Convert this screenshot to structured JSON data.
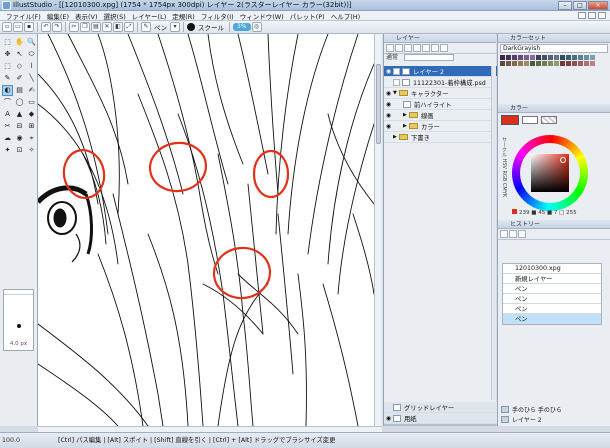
{
  "title_bar": {
    "title": "IllustStudio - [[12010300.xpg] (1754 * 1754px 300dpi)  レイヤー 2(ラスターレイヤー カラー(32bit))]",
    "window_buttons": [
      "–",
      "□",
      "×"
    ]
  },
  "menu": [
    "ファイル(F)",
    "編集(E)",
    "表示(V)",
    "選択(S)",
    "レイヤー(L)",
    "定規(R)",
    "フィルタ(I)",
    "ウィンドウ(W)",
    "パレット(P)",
    "ヘルプ(H)"
  ],
  "command_bar": {
    "tool_name": "ペン",
    "brush_label": "スクール",
    "badge": "3%",
    "icons": [
      "new-file-icon",
      "open-icon",
      "save-icon",
      "undo-icon",
      "redo-icon",
      "cut-icon",
      "copy-icon"
    ]
  },
  "tools": [
    "⬚",
    "✋",
    "🔍",
    "✥",
    "↖",
    "⬭",
    "⬚",
    "◇",
    "⌇",
    "✎",
    "✐",
    "╲",
    "◐",
    "▤",
    "✍",
    "⌒",
    "◯",
    "▭",
    "A",
    "▲",
    "◆",
    "✂",
    "⊟",
    "⊞",
    "☁",
    "◉",
    "⌖",
    "✦",
    "⊡",
    "✧"
  ],
  "brush_size": "4.0 px",
  "layer_panel": {
    "header": "レイヤー",
    "blend_mode": "通常",
    "layers": [
      {
        "name": "レイヤー 2",
        "selected": true,
        "indent": 0,
        "kind": "raster"
      },
      {
        "name": "11122301-着枠構成.psd",
        "selected": false,
        "indent": 0,
        "kind": "image"
      },
      {
        "name": "キャラクター",
        "selected": false,
        "indent": 0,
        "kind": "folder"
      },
      {
        "name": "前ハイライト",
        "selected": false,
        "indent": 1,
        "kind": "raster"
      },
      {
        "name": "線画",
        "selected": false,
        "indent": 2,
        "kind": "folder"
      },
      {
        "name": "カラー",
        "selected": false,
        "indent": 2,
        "kind": "folder"
      },
      {
        "name": "下書き",
        "selected": false,
        "indent": 1,
        "kind": "folder"
      }
    ],
    "bottom_layers": [
      "グリッドレイヤー",
      "用紙"
    ]
  },
  "color_set": {
    "header": "カラーセット",
    "name": "DarkGrayish"
  },
  "color_panel": {
    "header": "カラー",
    "main_color": "#d8301d",
    "tabs": [
      "サークル",
      "HSV",
      "RGB",
      "CMYK"
    ],
    "values": "239 ■ 45 ■ 7 □ 255"
  },
  "history": {
    "header": "ヒストリー",
    "items": [
      "12010300.xpg",
      "新規レイヤー",
      "ペン",
      "ペン",
      "ペン",
      "ペン"
    ],
    "selected_index": 5
  },
  "sub_panel": {
    "rows": [
      "手のひら 手のひら",
      "レイヤー 2"
    ]
  },
  "status": {
    "zoom": "100.0",
    "hint": "[Ctrl] パス編集 | [Alt] スポイト | [Shift] 直線を引く | [Ctrl] + [Alt] ドラッグでブラシサイズ変更"
  }
}
